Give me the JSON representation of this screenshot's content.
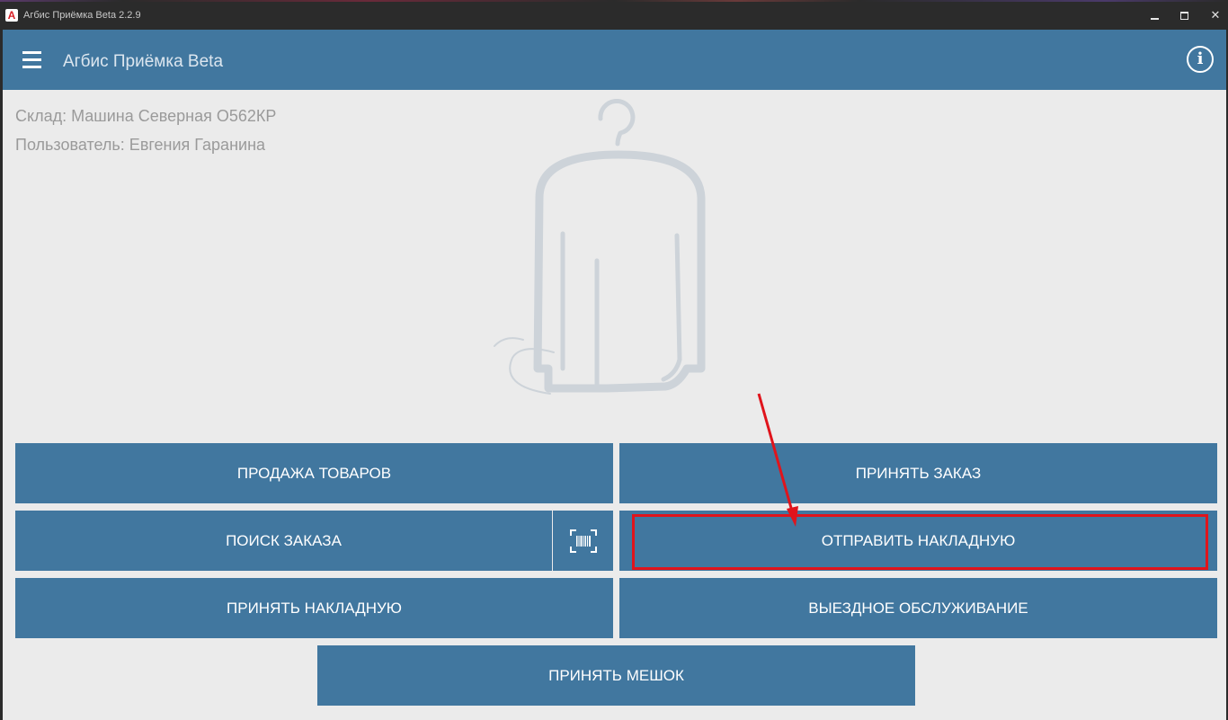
{
  "window": {
    "title": "Агбис Приёмка Beta 2.2.9",
    "icon": "app-logo-icon",
    "controls": {
      "minimize": "minimize-icon",
      "maximize": "maximize-icon",
      "close": "✕"
    }
  },
  "appbar": {
    "title": "Агбис Приёмка Beta",
    "menu_icon": "hamburger-menu-icon",
    "info_icon": "i"
  },
  "info": {
    "store": "Склад: Машина Северная О562КР",
    "user": "Пользователь: Евгения Гаранина"
  },
  "buttons": {
    "sale": "ПРОДАЖА ТОВАРОВ",
    "accept_order": "ПРИНЯТЬ ЗАКАЗ",
    "search_order": "ПОИСК ЗАКАЗА",
    "scan": "barcode-scan-icon",
    "send_invoice": "ОТПРАВИТЬ НАКЛАДНУЮ",
    "accept_invoice": "ПРИНЯТЬ НАКЛАДНУЮ",
    "field_service": "ВЫЕЗДНОЕ ОБСЛУЖИВАНИЕ",
    "accept_bag": "ПРИНЯТЬ МЕШОК"
  },
  "colors": {
    "primary": "#41779f",
    "background": "#ebebeb",
    "annotation": "#e0141c",
    "illustration": "#cdd3d9"
  }
}
